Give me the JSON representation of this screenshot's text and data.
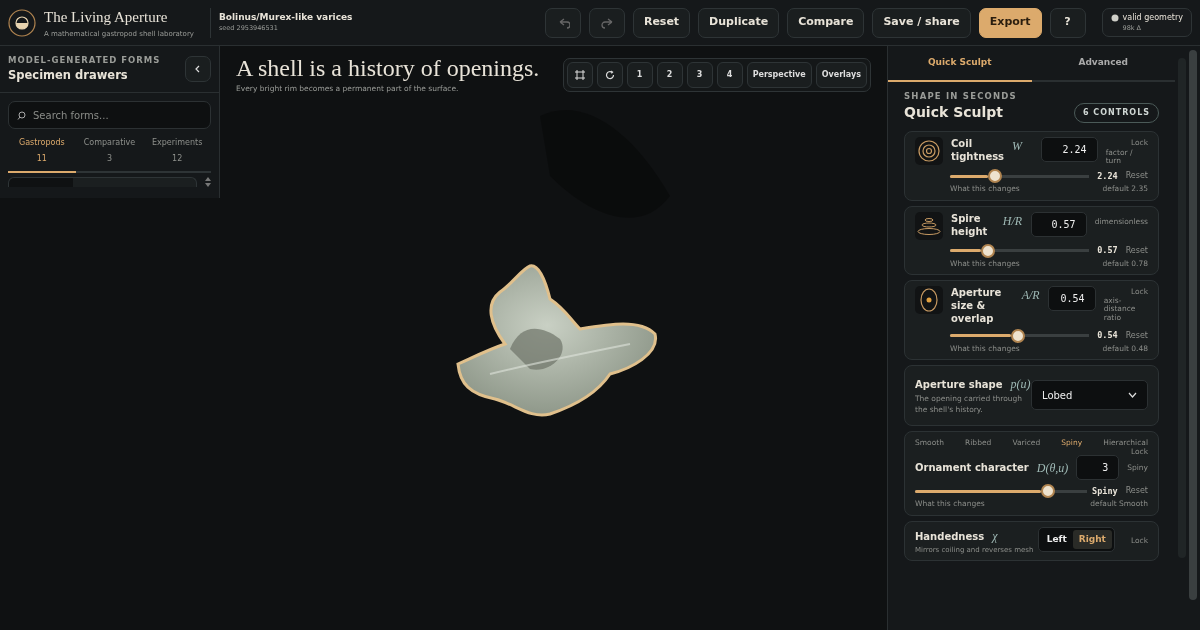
{
  "app": {
    "title": "The Living Aperture",
    "subtitle": "A mathematical gastropod shell laboratory"
  },
  "specimen": {
    "name": "Bolinus/Murex-like varices",
    "seed": "seed  2953946531"
  },
  "toolbar": [
    {
      "kind": "undo",
      "disabled": true
    },
    {
      "kind": "redo",
      "disabled": true
    },
    {
      "kind": "text",
      "label": "Reset",
      "primary": false
    },
    {
      "kind": "text",
      "label": "Duplicate",
      "primary": false
    },
    {
      "kind": "text",
      "label": "Compare",
      "primary": false
    },
    {
      "kind": "text",
      "label": "Save / share",
      "primary": false
    },
    {
      "kind": "text",
      "label": "Export",
      "primary": true
    },
    {
      "kind": "text",
      "label": "?",
      "primary": false
    }
  ],
  "status": {
    "label": "valid geometry",
    "detail": "98k Δ"
  },
  "sidebar": {
    "eyebrow": "MODEL-GENERATED FORMS",
    "title": "Specimen drawers",
    "search": {
      "placeholder": "Search forms..."
    },
    "tabs": [
      {
        "label": "Gastropods",
        "count": "11",
        "selected": true
      },
      {
        "label": "Comparative",
        "count": "3",
        "selected": false
      },
      {
        "label": "Experiments",
        "count": "12",
        "selected": false
      }
    ]
  },
  "viewport": {
    "title": "A shell is a history of openings.",
    "subtitle": "Every bright rim becomes a permanent part of the surface.",
    "view_buttons": [
      {
        "kind": "frame"
      },
      {
        "kind": "rotate"
      },
      {
        "kind": "text",
        "label": "1"
      },
      {
        "kind": "text",
        "label": "2"
      },
      {
        "kind": "text",
        "label": "3"
      },
      {
        "kind": "text",
        "label": "4"
      },
      {
        "kind": "text",
        "label": "Perspective"
      },
      {
        "kind": "text",
        "label": "Overlays"
      }
    ]
  },
  "panel": {
    "tabs": [
      {
        "label": "Quick Sculpt",
        "selected": true
      },
      {
        "label": "Advanced",
        "selected": false
      }
    ],
    "eyebrow": "SHAPE IN SECONDS",
    "title": "Quick Sculpt",
    "badge": "6 CONTROLS",
    "controls": [
      {
        "kind": "slider",
        "label": "Coil tightness",
        "symbol": "W",
        "value": "2.24",
        "lock": "Lock",
        "unit": "factor / turn",
        "reading": "2.24",
        "reset": "Reset",
        "help": "What this changes",
        "default": "default 2.35",
        "level": 0.27
      },
      {
        "kind": "slider",
        "label": "Spire height",
        "symbol": "H/R",
        "value": "0.57",
        "unit": "dimensionless",
        "reading": "0.57",
        "reset": "Reset",
        "help": "What this changes",
        "default": "default 0.78",
        "level": 0.22
      },
      {
        "kind": "slider",
        "label": "Aperture size & overlap",
        "symbol": "A/R",
        "value": "0.54",
        "lock": "Lock",
        "unit": "axis-distance ratio",
        "reading": "0.54",
        "reset": "Reset",
        "help": "What this changes",
        "default": "default 0.48",
        "level": 0.44
      },
      {
        "kind": "select",
        "label": "Aperture shape",
        "symbol": "p(u)",
        "description": "The opening carried through the shell's history.",
        "value": "Lobed"
      },
      {
        "kind": "stepped",
        "steps": [
          {
            "label": "Smooth",
            "selected": false
          },
          {
            "label": "Ribbed",
            "selected": false
          },
          {
            "label": "Variced",
            "selected": false
          },
          {
            "label": "Spiny",
            "selected": true
          },
          {
            "label": "Hierarchical",
            "selected": false
          }
        ],
        "lock": "Lock",
        "label": "Ornament character",
        "symbol": "D(θ,u)",
        "value": "3",
        "unit": "Spiny",
        "reading": "Spiny",
        "reset": "Reset",
        "help": "What this changes",
        "default": "default Smooth",
        "level": 0.73
      },
      {
        "kind": "toggle",
        "label": "Handedness",
        "symbol": "χ",
        "description": "Mirrors coiling and reverses mesh",
        "options": [
          {
            "label": "Left",
            "selected": false
          },
          {
            "label": "Right",
            "selected": true
          }
        ],
        "lock": "Lock"
      }
    ]
  }
}
